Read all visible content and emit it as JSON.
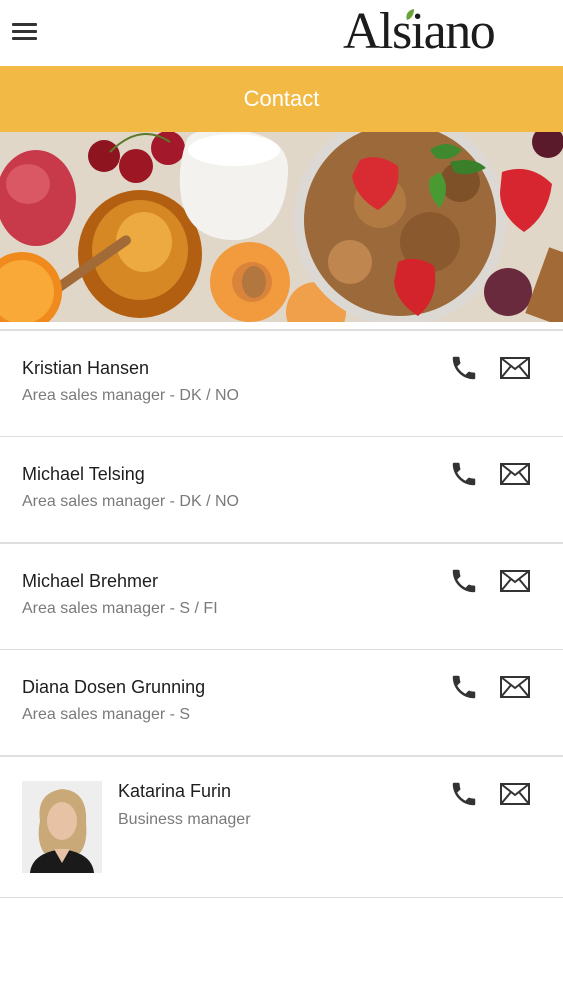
{
  "header": {
    "menu_icon": "hamburger-menu-icon",
    "logo_text": "Alsiano"
  },
  "page": {
    "title": "Contact"
  },
  "colors": {
    "accent": "#f2b944",
    "title_text": "#ffffff",
    "role_text": "#7a7a7a",
    "icon": "#333333"
  },
  "contacts": [
    {
      "name": "Kristian Hansen",
      "role": "Area sales manager - DK / NO",
      "phone_icon": "phone-icon",
      "email_icon": "email-icon"
    },
    {
      "name": "Michael Telsing",
      "role": "Area sales manager - DK / NO",
      "phone_icon": "phone-icon",
      "email_icon": "email-icon"
    },
    {
      "name": "Michael Brehmer",
      "role": "Area sales manager - S / FI",
      "phone_icon": "phone-icon",
      "email_icon": "email-icon"
    },
    {
      "name": "Diana Dosen Grunning",
      "role": "Area sales manager - S",
      "phone_icon": "phone-icon",
      "email_icon": "email-icon"
    },
    {
      "name": "Katarina Furin",
      "role": "Business manager",
      "phone_icon": "phone-icon",
      "email_icon": "email-icon",
      "has_photo": true
    }
  ]
}
